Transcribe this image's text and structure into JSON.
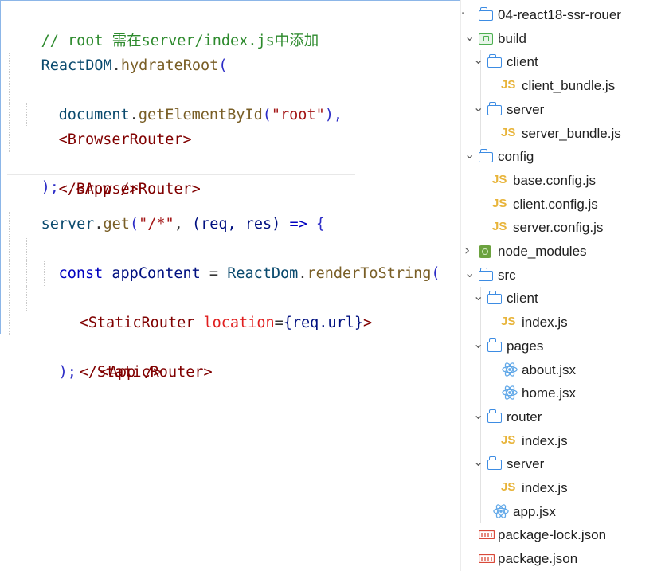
{
  "code": {
    "block1": {
      "comment": "// root 需在server/index.js中添加",
      "l2_obj": "ReactDOM",
      "l2_dot": ".",
      "l2_fn": "hydrateRoot",
      "l2_paren": "(",
      "l3_obj": "document",
      "l3_dot": ".",
      "l3_fn": "getElementById",
      "l3_open": "(",
      "l3_str": "\"root\"",
      "l3_close": "),",
      "l4_tag": "<BrowserRouter>",
      "l5_tag": "<App />",
      "l6_tag": "</BrowserRouter>",
      "l7": ");"
    },
    "block2": {
      "l1_obj": "server",
      "l1_dot": ".",
      "l1_fn": "get",
      "l1_open": "(",
      "l1_str": "\"/*\"",
      "l1_comma": ", ",
      "l1_params": "(req, res)",
      "l1_arrow": " => ",
      "l1_brace": "{",
      "l2_kw": "const",
      "l2_var": " appContent",
      "l2_eq": " = ",
      "l2_obj": "ReactDom",
      "l2_dot": ".",
      "l2_fn": "renderToString",
      "l2_paren": "(",
      "l3_tag": "<StaticRouter",
      "l3_attr": " location",
      "l3_eq": "=",
      "l3_val": "{req.url}",
      "l3_close": ">",
      "l4_tag": "<App />",
      "l5_tag": "</StaticRouter>",
      "l6": ");"
    }
  },
  "explorer": {
    "items": [
      {
        "label": "04-react18-ssr-rouer",
        "type": "folder",
        "icon": "folder-icon"
      },
      {
        "label": "build",
        "type": "folder-special",
        "icon": "build-folder-icon"
      },
      {
        "label": "client",
        "type": "folder",
        "icon": "folder-icon"
      },
      {
        "label": "client_bundle.js",
        "type": "js",
        "icon": "js-file-icon",
        "badge": "JS"
      },
      {
        "label": "server",
        "type": "folder",
        "icon": "folder-icon"
      },
      {
        "label": "server_bundle.js",
        "type": "js",
        "icon": "js-file-icon",
        "badge": "JS"
      },
      {
        "label": "config",
        "type": "folder",
        "icon": "folder-icon"
      },
      {
        "label": "base.config.js",
        "type": "js",
        "icon": "js-file-icon",
        "badge": "JS"
      },
      {
        "label": "client.config.js",
        "type": "js",
        "icon": "js-file-icon",
        "badge": "JS"
      },
      {
        "label": "server.config.js",
        "type": "js",
        "icon": "js-file-icon",
        "badge": "JS"
      },
      {
        "label": "node_modules",
        "type": "folder-node",
        "icon": "node-modules-folder-icon"
      },
      {
        "label": "src",
        "type": "folder",
        "icon": "folder-icon"
      },
      {
        "label": "client",
        "type": "folder",
        "icon": "folder-icon"
      },
      {
        "label": "index.js",
        "type": "js",
        "icon": "js-file-icon",
        "badge": "JS"
      },
      {
        "label": "pages",
        "type": "folder",
        "icon": "folder-icon"
      },
      {
        "label": "about.jsx",
        "type": "jsx",
        "icon": "react-icon"
      },
      {
        "label": "home.jsx",
        "type": "jsx",
        "icon": "react-icon"
      },
      {
        "label": "router",
        "type": "folder",
        "icon": "folder-icon"
      },
      {
        "label": "index.js",
        "type": "js",
        "icon": "js-file-icon",
        "badge": "JS"
      },
      {
        "label": "server",
        "type": "folder",
        "icon": "folder-icon"
      },
      {
        "label": "index.js",
        "type": "js",
        "icon": "js-file-icon",
        "badge": "JS"
      },
      {
        "label": "app.jsx",
        "type": "jsx",
        "icon": "react-icon"
      },
      {
        "label": "package-lock.json",
        "type": "json",
        "icon": "json-file-icon"
      },
      {
        "label": "package.json",
        "type": "json",
        "icon": "json-file-icon"
      }
    ],
    "colors": {
      "folder": "#3d8ce3",
      "js": "#e8b43a",
      "react": "#61a8e8",
      "json": "#d94a3a"
    }
  }
}
